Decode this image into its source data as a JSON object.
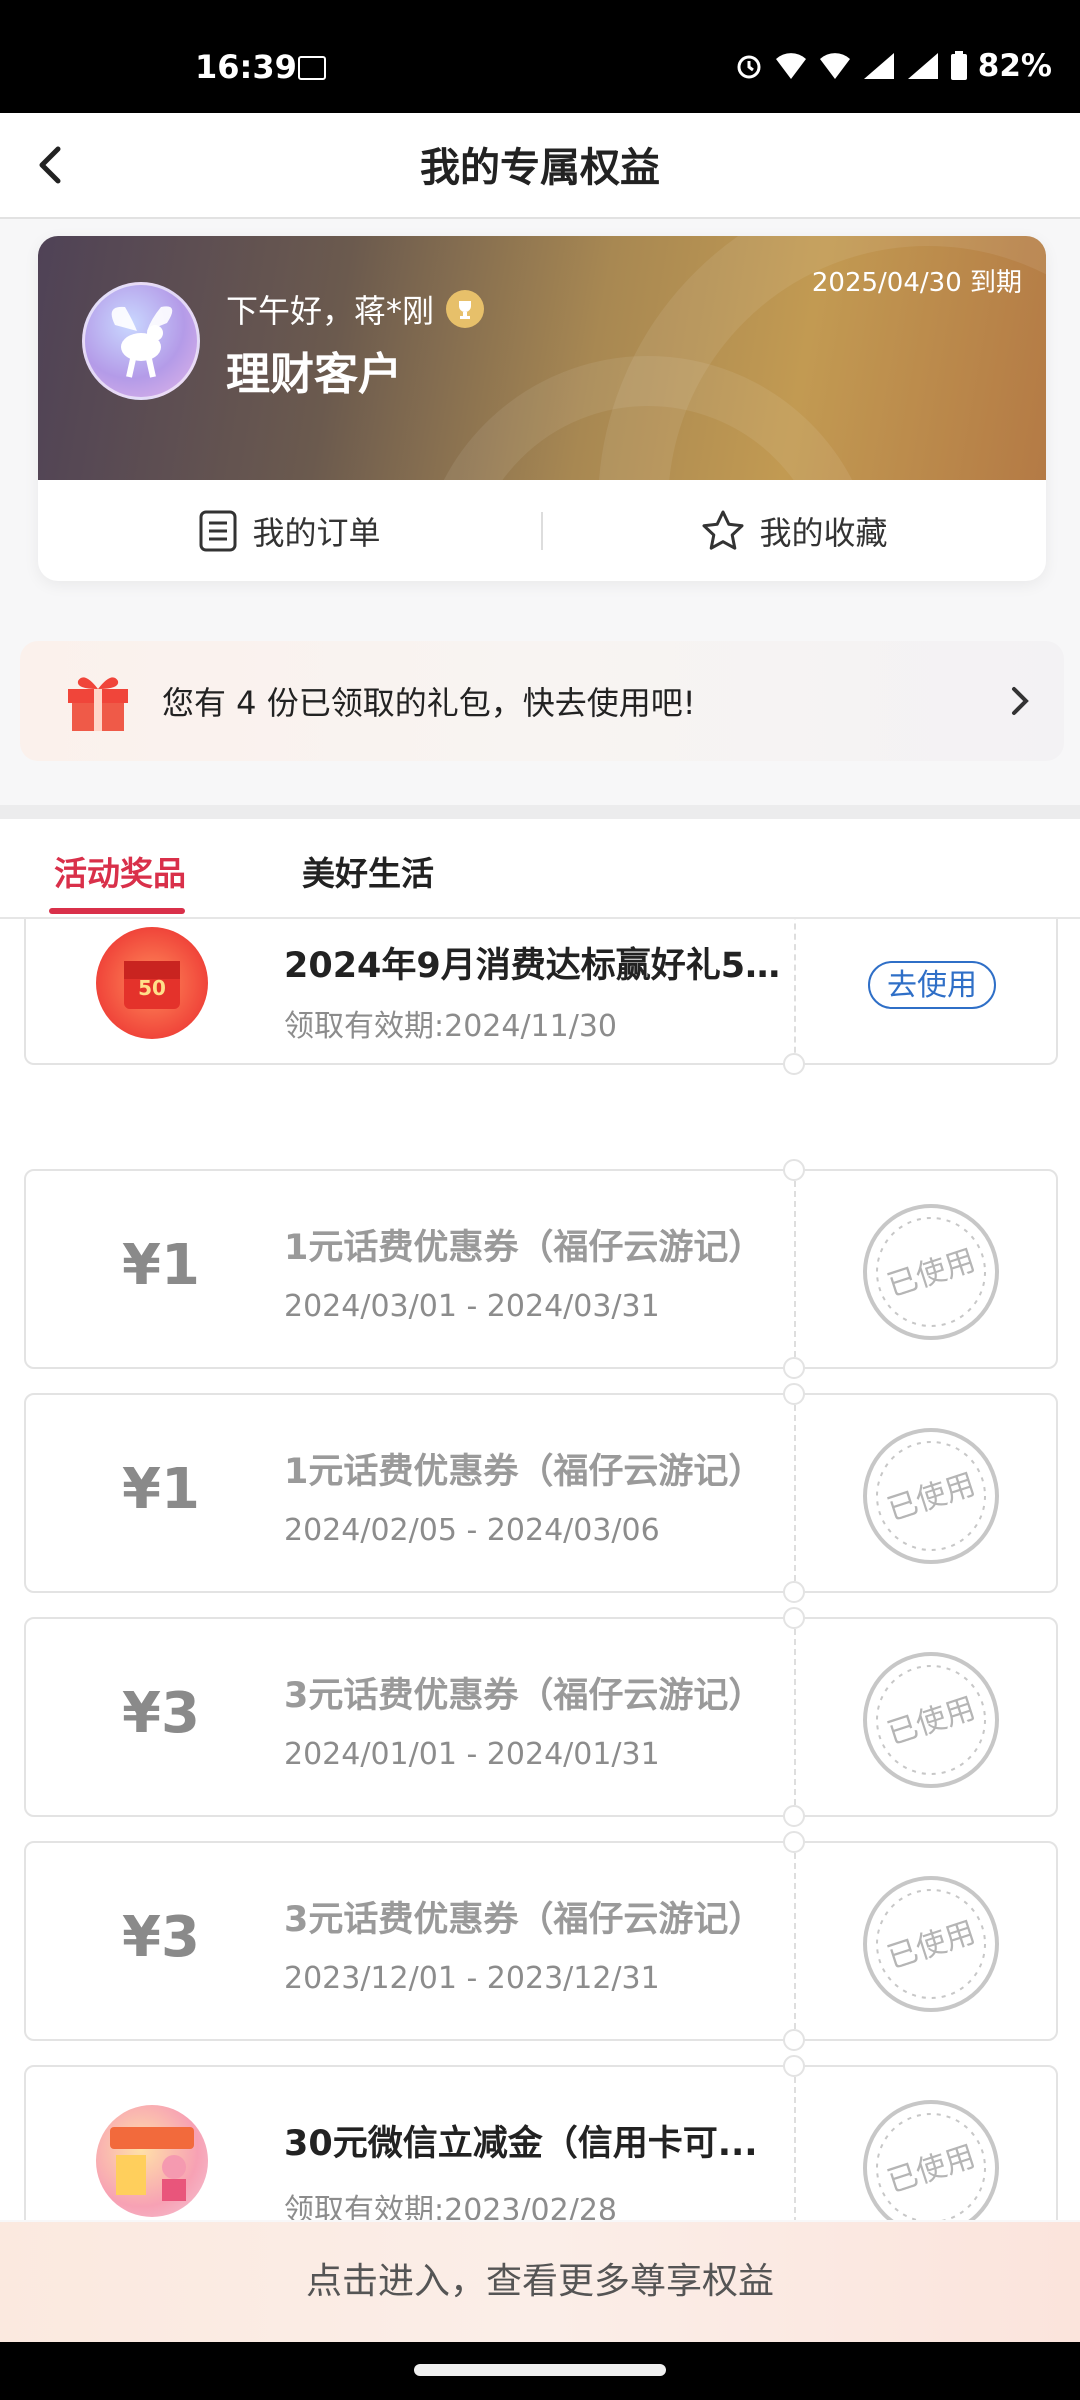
{
  "status_bar": {
    "time": "16:39",
    "battery": "82%"
  },
  "header": {
    "title": "我的专属权益"
  },
  "member_card": {
    "greeting": "下午好，蒋*刚",
    "customer_type": "理财客户",
    "expiry": "2025/04/30 到期",
    "actions": [
      {
        "label": "我的订单",
        "icon": "order-list-icon"
      },
      {
        "label": "我的收藏",
        "icon": "star-icon"
      }
    ]
  },
  "gift_banner": {
    "text": "您有 4 份已领取的礼包，快去使用吧!"
  },
  "tabs": [
    {
      "label": "活动奖品",
      "active": true
    },
    {
      "label": "美好生活",
      "active": false
    }
  ],
  "coupons": [
    {
      "title": "2024年9月消费达标赢好礼50...",
      "date": "领取有效期:2024/11/30",
      "amount": "",
      "status": "active",
      "action": "去使用",
      "image": "red-envelope-50",
      "image_text": "50"
    },
    {
      "title": "1元话费优惠券（福仔云游记）",
      "date": "2024/03/01 - 2024/03/31",
      "amount": "¥1",
      "status": "used",
      "stamp": "已使用"
    },
    {
      "title": "1元话费优惠券（福仔云游记）",
      "date": "2024/02/05 - 2024/03/06",
      "amount": "¥1",
      "status": "used",
      "stamp": "已使用"
    },
    {
      "title": "3元话费优惠券（福仔云游记）",
      "date": "2024/01/01 - 2024/01/31",
      "amount": "¥3",
      "status": "used",
      "stamp": "已使用"
    },
    {
      "title": "3元话费优惠券（福仔云游记）",
      "date": "2023/12/01 - 2023/12/31",
      "amount": "¥3",
      "status": "used",
      "stamp": "已使用"
    },
    {
      "title": "30元微信立减金（信用卡可...",
      "date": "领取有效期:2023/02/28",
      "amount": "",
      "status": "used",
      "stamp": "已使用",
      "image": "promo-poster"
    }
  ],
  "bottom_banner": {
    "text": "点击进入，查看更多尊享权益"
  },
  "colors": {
    "accent": "#d9304a",
    "link_blue": "#2f6fc7",
    "gold": "#c29a52"
  }
}
